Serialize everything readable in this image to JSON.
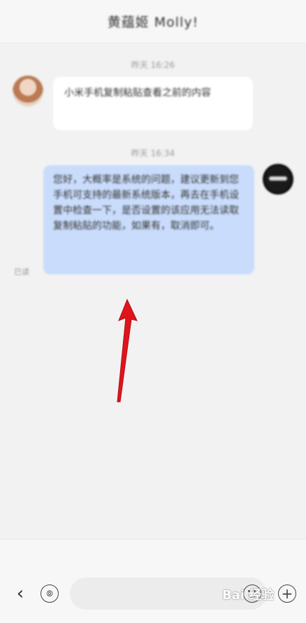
{
  "header": {
    "title": "黄蕴姬 Molly!"
  },
  "messages": [
    {
      "time": "昨天 16:26",
      "direction": "incoming",
      "text": "小米手机复制粘贴查看之前的内容"
    },
    {
      "time": "昨天 16:34",
      "direction": "outgoing",
      "text": "您好，大概率是系统的问题，建议更新到您手机可支持的最新系统版本，再去在手机设置中检查一下，是否设置的该应用无法读取复制粘贴的功能，如果有，取消即可。",
      "status": "已读"
    }
  ],
  "input": {
    "placeholder": ""
  },
  "icons": {
    "back": "chevron-left-icon",
    "voice": "voice-icon",
    "emoji": "emoji-icon",
    "plus": "plus-icon"
  },
  "colors": {
    "outgoing_bubble": "#c9dcfb",
    "incoming_bubble": "#ffffff",
    "annotation_arrow": "#e0141c"
  },
  "watermark": {
    "text": "Bai 经验"
  }
}
